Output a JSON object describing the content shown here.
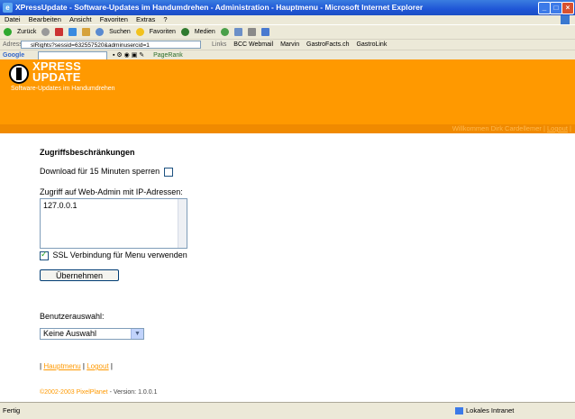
{
  "window": {
    "title": "XPressUpdate - Software-Updates im Handumdrehen - Administration - Hauptmenu - Microsoft Internet Explorer"
  },
  "menubar": {
    "items": [
      "Datei",
      "Bearbeiten",
      "Ansicht",
      "Favoriten",
      "Extras",
      "?"
    ]
  },
  "toolbar": {
    "back": "Zurück",
    "search": "Suchen",
    "favorites": "Favoriten",
    "media": "Medien"
  },
  "address": {
    "label": "Adresse",
    "value": "slRights?sessid=632557520&adminusercid=1",
    "links_label": "Links",
    "links": [
      "BCC Webmail",
      "Marvin",
      "GastroFacts.ch",
      "GastroLink"
    ]
  },
  "googlebar": {
    "label": "Google",
    "pagerank": "PageRank"
  },
  "banner": {
    "logo_line1": "XPRESS",
    "logo_line2": "UPDATE",
    "subtitle": "Software-Updates im Handumdrehen"
  },
  "userbar": {
    "welcome": "Willkommen Dirk Cardellemer",
    "logout": "Logout"
  },
  "form": {
    "heading": "Zugriffsbeschränkungen",
    "download_label": "Download für 15 Minuten sperren",
    "ip_label": "Zugriff auf Web-Admin mit IP-Adressen:",
    "ip_value": "127.0.0.1",
    "ssl_label": "SSL Verbindung für Menu verwenden",
    "submit_label": "Übernehmen",
    "user_select_label": "Benutzerauswahl:",
    "user_select_value": "Keine Auswahl"
  },
  "footer": {
    "link_main": "Hauptmenu",
    "link_logout": "Logout",
    "copyright": "©2002-2003 PixelPlanet",
    "version": "- Version: 1.0.0.1"
  },
  "statusbar": {
    "status": "Fertig",
    "zone": "Lokales Intranet"
  },
  "colors": {
    "banner": "#ff9900",
    "userbar": "#f08a00",
    "titlebar": "#1f56d6"
  }
}
